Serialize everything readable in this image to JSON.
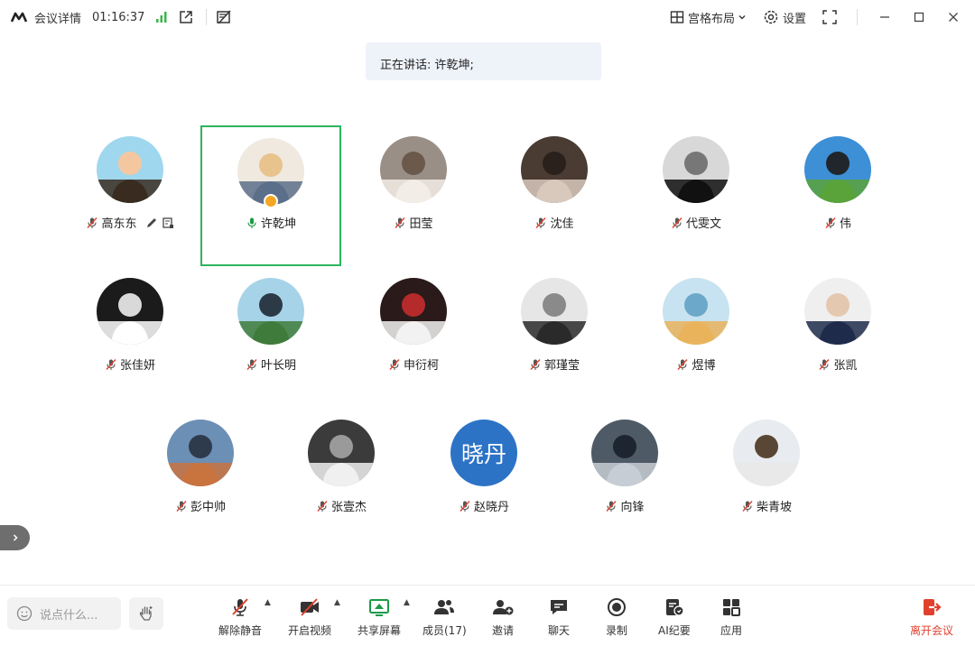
{
  "topbar": {
    "meeting_info": "会议详情",
    "duration": "01:16:37",
    "layout_label": "宫格布局",
    "settings_label": "设置"
  },
  "speaking": {
    "text": "正在讲话: 许乾坤;"
  },
  "participants": [
    {
      "name": "高东东",
      "muted": true
    },
    {
      "name": "许乾坤",
      "muted": false,
      "active": true,
      "host": true
    },
    {
      "name": "田莹",
      "muted": true
    },
    {
      "name": "沈佳",
      "muted": true
    },
    {
      "name": "代雯文",
      "muted": true
    },
    {
      "name": "伟",
      "muted": true
    },
    {
      "name": "张佳妍",
      "muted": true
    },
    {
      "name": "叶长明",
      "muted": true
    },
    {
      "name": "申衍柯",
      "muted": true
    },
    {
      "name": "郭瑾莹",
      "muted": true
    },
    {
      "name": "煜博",
      "muted": true
    },
    {
      "name": "张凯",
      "muted": true
    },
    {
      "name": "彭中帅",
      "muted": true
    },
    {
      "name": "张壹杰",
      "muted": true
    },
    {
      "name": "赵晓丹",
      "muted": true,
      "avatar_text": "晓丹"
    },
    {
      "name": "向锋",
      "muted": true
    },
    {
      "name": "柴青坡",
      "muted": true
    }
  ],
  "chat": {
    "placeholder": "说点什么..."
  },
  "toolbar": {
    "unmute": "解除静音",
    "video": "开启视频",
    "share": "共享屏幕",
    "members": "成员(17)",
    "invite": "邀请",
    "chat": "聊天",
    "record": "录制",
    "ai_notes": "AI纪要",
    "apps": "应用",
    "leave": "离开会议"
  },
  "colors": {
    "accent_green": "#2db55d",
    "leave_red": "#e0412f",
    "signal_green": "#3bb54a",
    "banner_bg": "#eef2f9",
    "host_badge": "#f5a623",
    "xiaodan_avatar": "#2c73c6"
  }
}
